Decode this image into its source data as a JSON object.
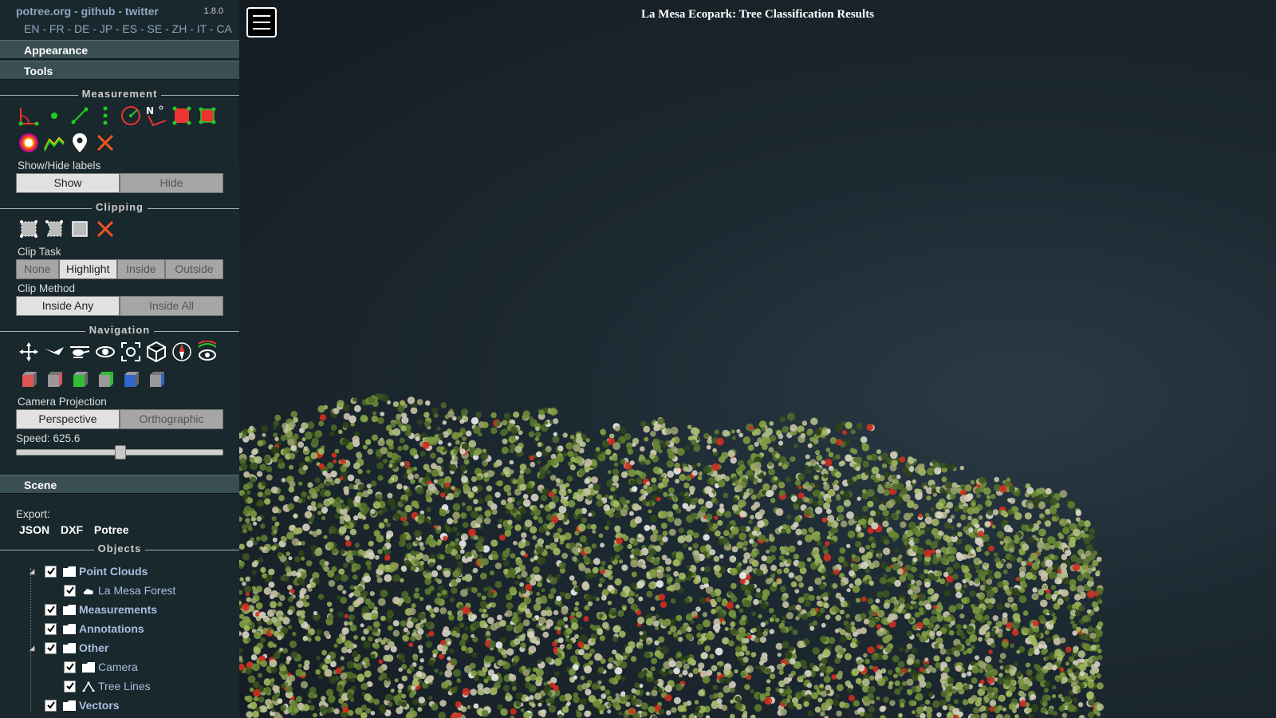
{
  "header": {
    "links": "potree.org - github - twitter",
    "version": "1.8.0",
    "languages": "EN - FR - DE - JP - ES - SE - ZH - IT - CA"
  },
  "menus": {
    "appearance": "Appearance",
    "tools": "Tools",
    "scene": "Scene"
  },
  "measurement": {
    "section_title": "Measurement",
    "labels_caption": "Show/Hide labels",
    "show_label": "Show",
    "hide_label": "Hide"
  },
  "clipping": {
    "section_title": "Clipping",
    "task_caption": "Clip Task",
    "tasks": [
      "None",
      "Highlight",
      "Inside",
      "Outside"
    ],
    "active_task": "Highlight",
    "method_caption": "Clip Method",
    "methods": [
      "Inside Any",
      "Inside All"
    ],
    "active_method": "Inside Any"
  },
  "navigation": {
    "section_title": "Navigation",
    "projection_caption": "Camera Projection",
    "perspective_label": "Perspective",
    "orthographic_label": "Orthographic",
    "speed_text": "Speed: 625.6",
    "speed_fraction": 0.5
  },
  "scene": {
    "export_caption": "Export:",
    "export_json": "JSON",
    "export_dxf": "DXF",
    "export_potree": "Potree",
    "objects_title": "Objects",
    "tree": {
      "point_clouds": "Point Clouds",
      "la_mesa_forest": "La Mesa Forest",
      "measurements": "Measurements",
      "annotations": "Annotations",
      "other": "Other",
      "camera": "Camera",
      "tree_lines": "Tree Lines",
      "vectors": "Vectors"
    }
  },
  "viewer": {
    "title": "La Mesa Ecopark: Tree Classification Results"
  },
  "colors": {
    "sidebar_bg": "#19282c",
    "menu_header_bg": "#3a4f54",
    "link_color": "#8fa7c0",
    "tree_label_color": "#a8bfe0"
  }
}
